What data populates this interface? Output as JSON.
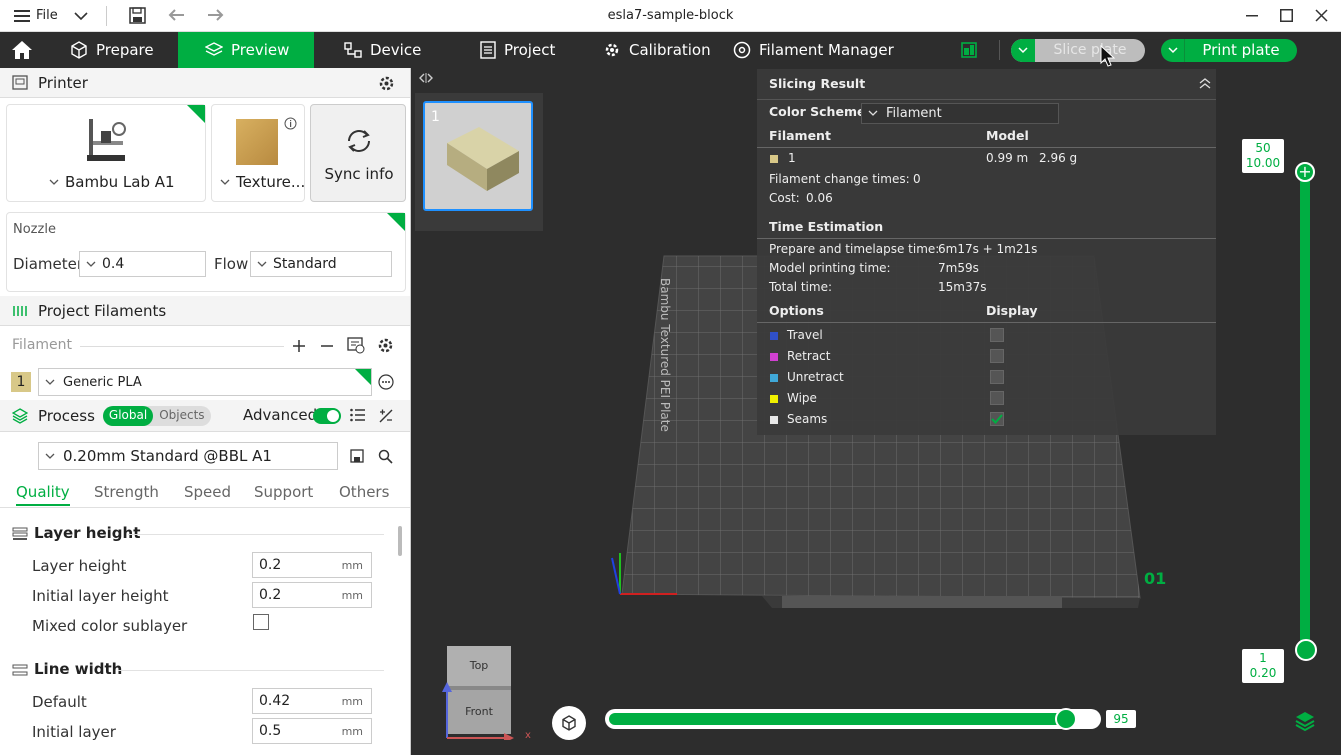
{
  "window": {
    "title": "esla7-sample-block",
    "file_menu": "File"
  },
  "tabs": {
    "prepare": "Prepare",
    "preview": "Preview",
    "device": "Device",
    "project": "Project",
    "calibration": "Calibration",
    "filament_manager": "Filament Manager"
  },
  "actions": {
    "slice": "Slice plate",
    "print": "Print plate"
  },
  "printer": {
    "header": "Printer",
    "name": "Bambu Lab A1",
    "plate": "Texture...",
    "sync": "Sync info",
    "nozzle_label": "Nozzle",
    "diameter_label": "Diameter",
    "diameter": "0.4",
    "flow_label": "Flow",
    "flow": "Standard"
  },
  "filaments": {
    "header": "Project Filaments",
    "label": "Filament",
    "index": "1",
    "name": "Generic PLA",
    "swatch": "#d8c888"
  },
  "process": {
    "header": "Process",
    "global": "Global",
    "objects": "Objects",
    "advanced": "Advanced",
    "preset": "0.20mm Standard @BBL A1",
    "tabs": [
      "Quality",
      "Strength",
      "Speed",
      "Support",
      "Others"
    ],
    "layer_group": "Layer height",
    "layer_height_label": "Layer height",
    "layer_height": "0.2",
    "initial_layer_height_label": "Initial layer height",
    "initial_layer_height": "0.2",
    "mixed_label": "Mixed color sublayer",
    "line_group": "Line width",
    "default_label": "Default",
    "default": "0.42",
    "initial_layer_label": "Initial layer",
    "initial_layer": "0.5",
    "unit": "mm"
  },
  "plate_thumb": {
    "number": "1"
  },
  "result": {
    "title": "Slicing Result",
    "color_scheme_label": "Color Scheme",
    "color_scheme": "Filament",
    "filament_col": "Filament",
    "model_col": "Model",
    "filament_index": "1",
    "model_length": "0.99 m",
    "model_weight": "2.96 g",
    "change_times_label": "Filament change times:",
    "change_times": "0",
    "cost_label": "Cost:",
    "cost": "0.06",
    "time_header": "Time Estimation",
    "prepare_label": "Prepare and timelapse time:",
    "prepare": "6m17s + 1m21s",
    "model_time_label": "Model printing time:",
    "model_time": "7m59s",
    "total_label": "Total time:",
    "total": "15m37s",
    "options_col": "Options",
    "display_col": "Display",
    "options": [
      {
        "name": "Travel",
        "color": "#3050c8",
        "checked": false
      },
      {
        "name": "Retract",
        "color": "#d040d0",
        "checked": false
      },
      {
        "name": "Unretract",
        "color": "#40a8d8",
        "checked": false
      },
      {
        "name": "Wipe",
        "color": "#f0f000",
        "checked": false
      },
      {
        "name": "Seams",
        "color": "#e8e8e8",
        "checked": true
      }
    ]
  },
  "bed": {
    "label": "Bambu Textured PEI Plate",
    "plate_number": "01"
  },
  "vslider": {
    "top_layer": "50",
    "top_height": "10.00",
    "bottom_layer": "1",
    "bottom_height": "0.20"
  },
  "hslider": {
    "value": "95",
    "fraction": 0.93
  },
  "navcube": {
    "top": "Top",
    "front": "Front",
    "x": "x"
  }
}
